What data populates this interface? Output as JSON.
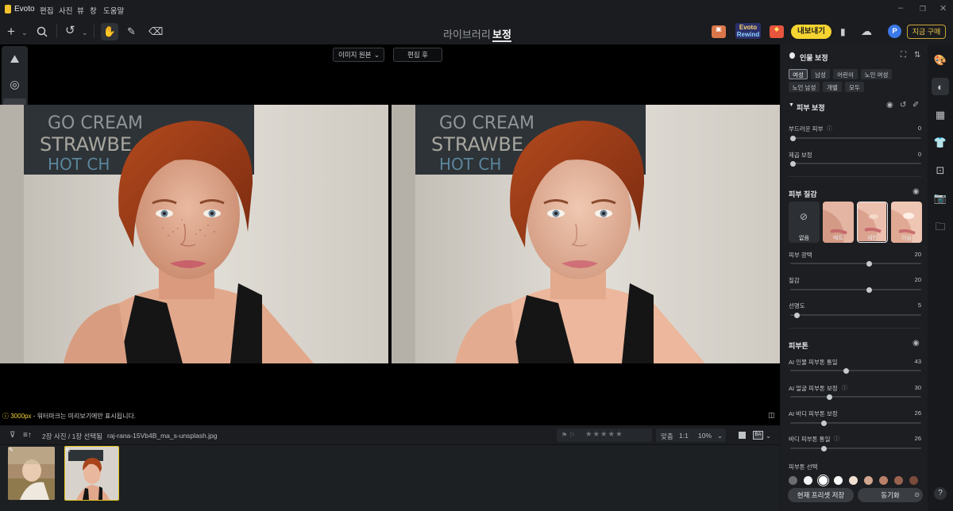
{
  "app": {
    "name": "Evoto"
  },
  "menu": [
    "편집",
    "사진",
    "뷰",
    "창",
    "도움말"
  ],
  "tabs": {
    "library": "라이브러리",
    "retouch": "보정"
  },
  "toolbar": {
    "export": "내보내기",
    "avatar_letter": "P",
    "buy": "지금 구매",
    "rewind_badge_line1": "Evoto",
    "rewind_badge_line2": "Rewind"
  },
  "viewer": {
    "compare_select": "이미지 원본",
    "after_label": "편집 후",
    "info_px": "3000px",
    "info_text": " - 워터마크는 미리보기에만 표시됩니다."
  },
  "film": {
    "count": "2장 사진 / 1장 선택됨",
    "filename": "raj-rana-15Vb4B_ma_s-unsplash.jpg",
    "fit": "맞춤",
    "one_to_one": "1:1",
    "zoom": "10%",
    "rating": 0
  },
  "panel": {
    "portrait_title": "인물 보정",
    "chips": [
      "여성",
      "남성",
      "어린이",
      "노인 여성",
      "노인 남성",
      "개별",
      "모두"
    ],
    "skin_retouch": {
      "title": "피부 보정",
      "sliders": [
        {
          "label": "부드러운 피부",
          "value": 0,
          "level": 0
        },
        {
          "label": "제곱 보정",
          "value": 0,
          "level": 0
        }
      ]
    },
    "skin_texture": {
      "title": "피부 질감",
      "cards": [
        "없음",
        "매트",
        "새틴",
        "이슬"
      ],
      "selected": "새틴",
      "sliders": [
        {
          "label": "피부 광택",
          "value": 20,
          "level": 0.6
        },
        {
          "label": "질감",
          "value": 20,
          "level": 0.6
        },
        {
          "label": "선명도",
          "value": 5,
          "level": 0.05
        }
      ]
    },
    "skin_tone": {
      "title": "피부톤",
      "sliders": [
        {
          "label": "AI 인물 피부톤 통일",
          "value": 43,
          "level": 0.43
        },
        {
          "label": "AI 얼굴 피부톤 보정",
          "value": 30,
          "level": 0.3
        },
        {
          "label": "AI 바디 피부톤 보정",
          "value": 26,
          "level": 0.26
        },
        {
          "label": "바디 피부톤 통일",
          "value": 26,
          "level": 0.26
        }
      ],
      "select_label": "피부톤 선택",
      "swatches": [
        "#6a6d72",
        "#f4f4f4",
        "#ffffff",
        "#fafafa",
        "#f0e0d2",
        "#d2a68f",
        "#b98068",
        "#9a6350",
        "#7a4a3b"
      ]
    },
    "save_preset": "현재 프리셋 저장",
    "sync": "동기화"
  },
  "colors": {
    "accent_yellow": "#f5d431",
    "avatar_blue": "#3c78e8",
    "panel_bg": "#1c1e21"
  }
}
